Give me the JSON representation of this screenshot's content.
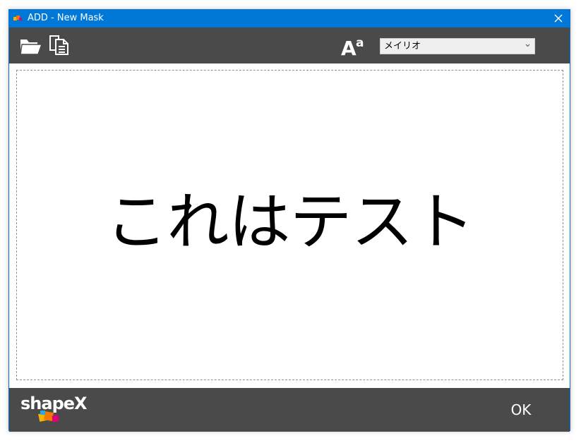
{
  "window": {
    "title": "ADD - New Mask"
  },
  "toolbar": {
    "open_icon": "folder-open-icon",
    "copy_icon": "copy-icon",
    "font_size_icon": "font-size-icon",
    "font_select": {
      "value": "メイリオ"
    }
  },
  "canvas": {
    "mask_text": "これはテスト"
  },
  "footer": {
    "logo_text": "shapeX",
    "ok_label": "OK"
  },
  "colors": {
    "titlebar": "#0078d7",
    "toolbar": "#4a4a4a",
    "footer": "#4a4a4a"
  }
}
